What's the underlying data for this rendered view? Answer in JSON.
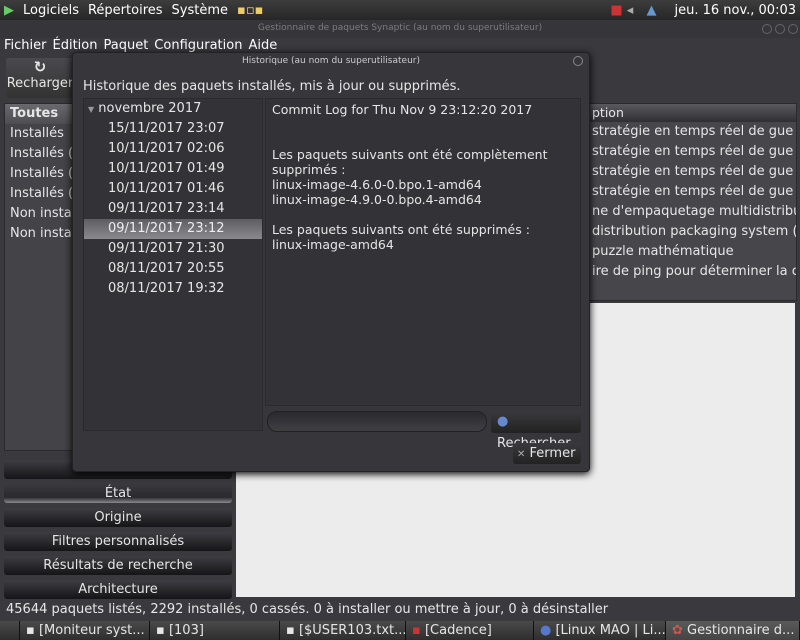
{
  "top_panel": {
    "menus": [
      "Logiciels",
      "Répertoires",
      "Système"
    ],
    "clock": "jeu. 16 nov., 00:03"
  },
  "main_window": {
    "title": "Gestionnaire de paquets Synaptic  (au nom du superutilisateur)",
    "menu": [
      "Fichier",
      "Édition",
      "Paquet",
      "Configuration",
      "Aide"
    ],
    "reload_label": "Recharger",
    "filters": [
      "Toutes",
      "Installés",
      "Installés (l",
      "Installés (",
      "Installés (",
      "Non instal",
      "Non instal"
    ],
    "column_header": "ption",
    "descriptions": [
      " stratégie en temps réel de gue",
      " stratégie en temps réel de gue",
      " stratégie en temps réel de gue",
      " stratégie en temps réel de gue",
      "ne d'empaquetage multidistribu",
      "distribution packaging system (",
      "  puzzle mathématique",
      "ire de ping pour déterminer la c"
    ],
    "filter_buttons": [
      "État",
      "Origine",
      "Filtres personnalisés",
      "Résultats de recherche",
      "Architecture"
    ],
    "status": "45644 paquets listés, 2292 installés, 0 cassés. 0 à installer ou mettre à jour, 0 à désinstaller"
  },
  "taskbar": [
    "[Moniteur syst...",
    "[103]",
    "[$USER103.txt...",
    "[Cadence]",
    "[Linux MAO | Li...",
    "Gestionnaire d..."
  ],
  "dialog": {
    "title": "Historique (au nom du superutilisateur)",
    "heading": "Historique des paquets installés, mis à jour ou supprimés.",
    "month": "novembre 2017",
    "entries": [
      "15/11/2017 23:07",
      "10/11/2017 02:06",
      "10/11/2017 01:49",
      "10/11/2017 01:46",
      "09/11/2017 23:14",
      "09/11/2017 23:12",
      "09/11/2017 21:30",
      "08/11/2017 20:55",
      "08/11/2017 19:32"
    ],
    "log": {
      "title": "Commit Log for Thu Nov  9 23:12:20 2017",
      "purged_heading": "Les paquets suivants ont été complètement supprimés :",
      "purged": [
        "linux-image-4.6.0-0.bpo.1-amd64",
        "linux-image-4.9.0-0.bpo.4-amd64"
      ],
      "removed_heading": "Les paquets suivants ont été supprimés :",
      "removed": [
        "linux-image-amd64"
      ]
    },
    "search_value": "",
    "search_label": "Rechercher",
    "close_label": "Fermer"
  }
}
